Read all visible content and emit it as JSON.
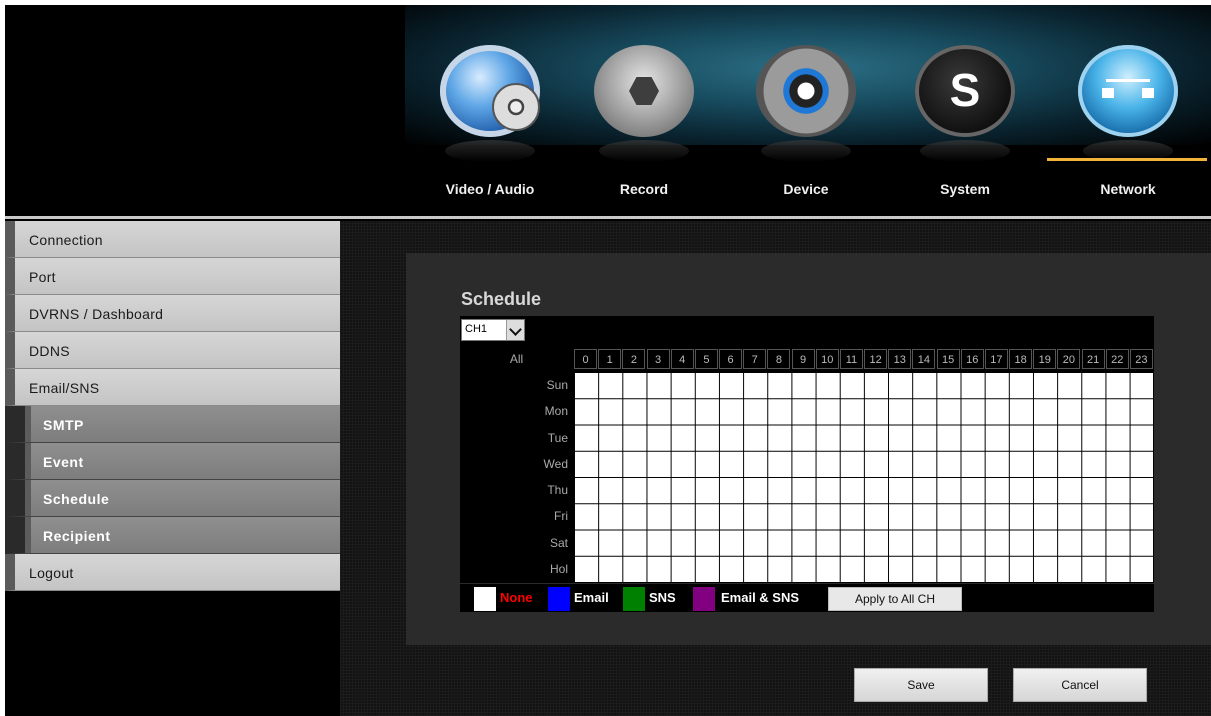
{
  "nav": {
    "items": [
      {
        "label": "Video / Audio",
        "icon": "video-audio-icon"
      },
      {
        "label": "Record",
        "icon": "record-icon"
      },
      {
        "label": "Device",
        "icon": "device-icon"
      },
      {
        "label": "System",
        "icon": "system-icon"
      },
      {
        "label": "Network",
        "icon": "network-icon"
      }
    ],
    "active": "Network",
    "accent_color": "#f3b43c"
  },
  "sidebar": {
    "items": [
      {
        "label": "Connection",
        "level": 1
      },
      {
        "label": "Port",
        "level": 1
      },
      {
        "label": "DVRNS / Dashboard",
        "level": 1
      },
      {
        "label": "DDNS",
        "level": 1
      },
      {
        "label": "Email/SNS",
        "level": 1
      },
      {
        "label": "SMTP",
        "level": 2
      },
      {
        "label": "Event",
        "level": 2
      },
      {
        "label": "Schedule",
        "level": 2
      },
      {
        "label": "Recipient",
        "level": 2
      },
      {
        "label": "Logout",
        "level": 1
      }
    ]
  },
  "schedule": {
    "title": "Schedule",
    "channel": "CH1",
    "all_label": "All",
    "hours": [
      "0",
      "1",
      "2",
      "3",
      "4",
      "5",
      "6",
      "7",
      "8",
      "9",
      "10",
      "11",
      "12",
      "13",
      "14",
      "15",
      "16",
      "17",
      "18",
      "19",
      "20",
      "21",
      "22",
      "23"
    ],
    "days": [
      "Sun",
      "Mon",
      "Tue",
      "Wed",
      "Thu",
      "Fri",
      "Sat",
      "Hol"
    ]
  },
  "legend": {
    "none": {
      "label": "None",
      "color": "#ffffff",
      "text_color": "#ff0000"
    },
    "email": {
      "label": "Email",
      "color": "#0000ff",
      "text_color": "#ffffff"
    },
    "sns": {
      "label": "SNS",
      "color": "#008000",
      "text_color": "#ffffff"
    },
    "email_sns": {
      "label": "Email & SNS",
      "color": "#800080",
      "text_color": "#ffffff"
    },
    "apply_label": "Apply to All CH"
  },
  "buttons": {
    "save": "Save",
    "cancel": "Cancel"
  }
}
